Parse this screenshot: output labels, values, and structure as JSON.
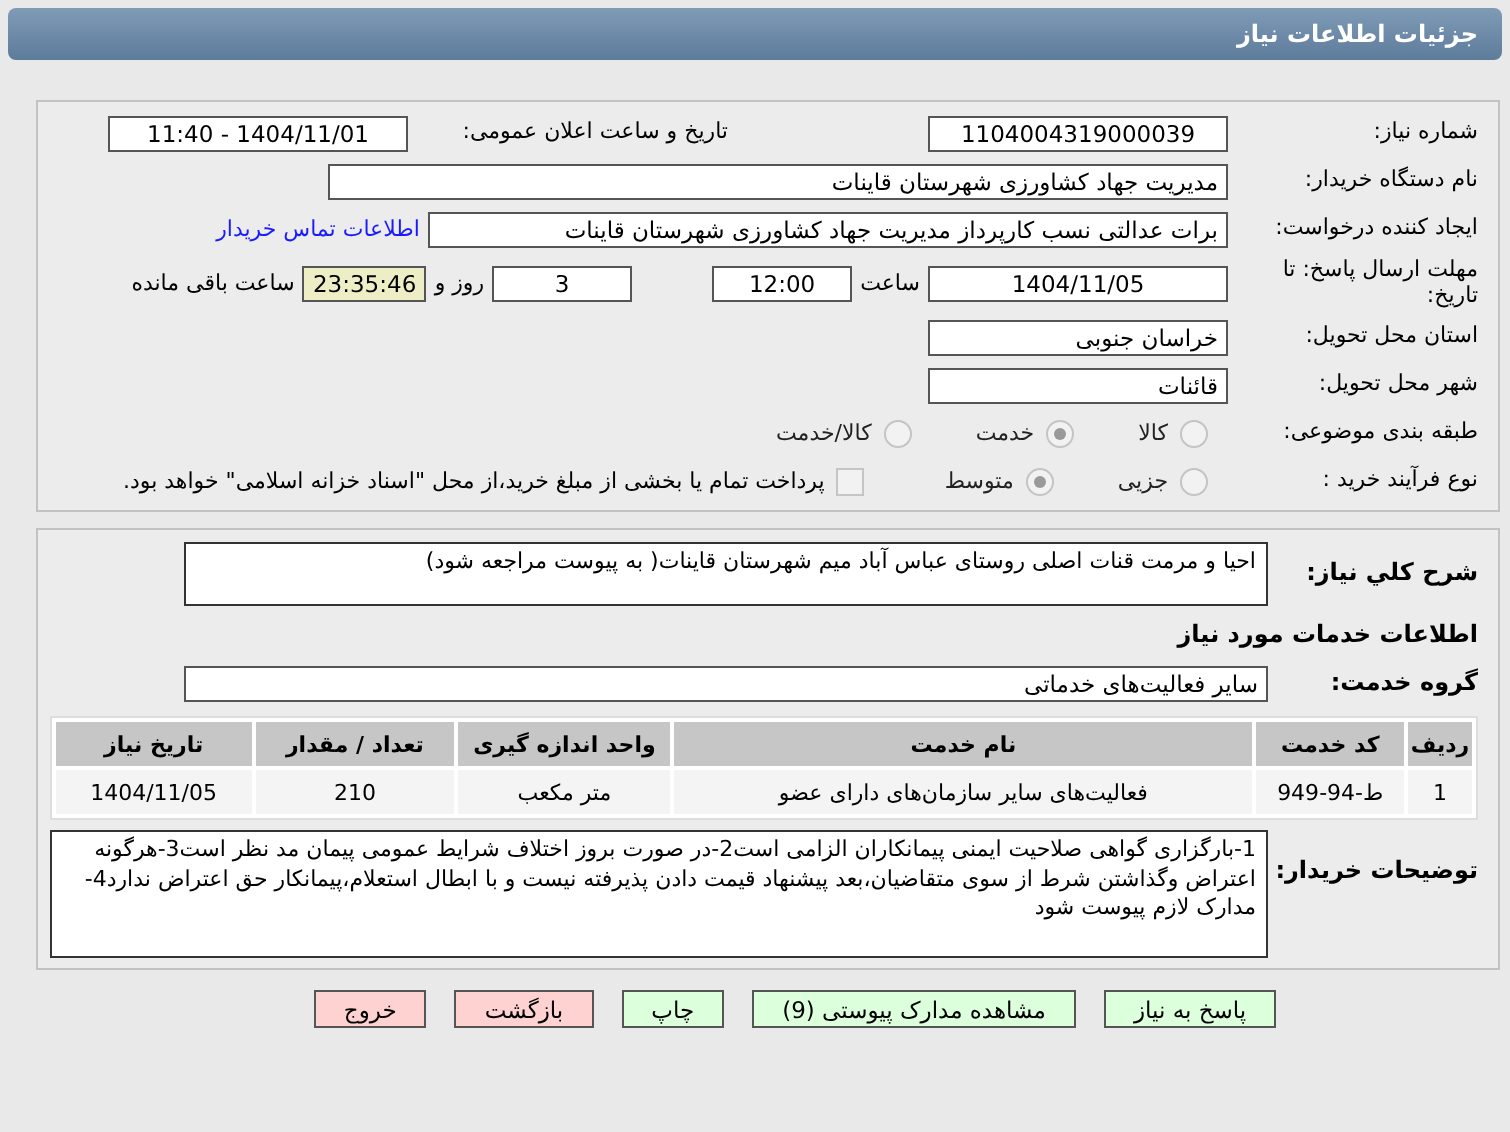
{
  "header": {
    "title": "جزئیات اطلاعات نیاز"
  },
  "details": {
    "need_number": {
      "label": "شماره نیاز:",
      "value": "1104004319000039"
    },
    "announce": {
      "label": "تاریخ و ساعت اعلان عمومی:",
      "value": "1404/11/01 - 11:40"
    },
    "buyer": {
      "label": "نام دستگاه خریدار:",
      "value": "مدیریت جهاد کشاورزی شهرستان قاینات"
    },
    "creator": {
      "label": "ایجاد کننده درخواست:",
      "value": "برات عدالتی نسب کارپرداز مدیریت جهاد کشاورزی شهرستان قاینات",
      "link": "اطلاعات تماس خریدار"
    },
    "deadline": {
      "label": "مهلت ارسال پاسخ: تا تاریخ:",
      "date": "1404/11/05",
      "time_label": "ساعت",
      "time": "12:00",
      "days": "3",
      "days_label": "روز و",
      "remaining": "23:35:46",
      "remaining_label": "ساعت باقی مانده"
    },
    "province": {
      "label": "استان محل تحویل:",
      "value": "خراسان جنوبی"
    },
    "city": {
      "label": "شهر محل تحویل:",
      "value": "قائنات"
    },
    "category": {
      "label": "طبقه بندی موضوعی:",
      "options": [
        {
          "label": "کالا",
          "selected": false
        },
        {
          "label": "خدمت",
          "selected": true
        },
        {
          "label": "کالا/خدمت",
          "selected": false
        }
      ]
    },
    "process": {
      "label": "نوع فرآیند خرید :",
      "options": [
        {
          "label": "جزیی",
          "selected": false
        },
        {
          "label": "متوسط",
          "selected": true
        }
      ],
      "payment": {
        "label": "پرداخت تمام یا بخشی از مبلغ خرید،از محل \"اسناد خزانه اسلامی\" خواهد بود.",
        "checked": false
      }
    }
  },
  "services": {
    "description": {
      "label": "شرح کلي نياز:",
      "value": "احیا و مرمت قنات اصلی روستای عباس آباد میم شهرستان قاینات( به پیوست مراجعه شود)"
    },
    "heading": "اطلاعات خدمات مورد نیاز",
    "group": {
      "label": "گروه خدمت:",
      "value": "سایر فعالیت‌های خدماتی"
    },
    "table": {
      "columns": [
        "ردیف",
        "کد خدمت",
        "نام خدمت",
        "واحد اندازه گیری",
        "تعداد / مقدار",
        "تاریخ نیاز"
      ],
      "rows": [
        [
          "1",
          "ط-94-949",
          "فعالیت‌های سایر سازمان‌های دارای عضو",
          "متر مکعب",
          "210",
          "1404/11/05"
        ]
      ]
    },
    "notes": {
      "label": "توضیحات خریدار:",
      "value": "1-بارگزاری گواهی صلاحیت ایمنی پیمانکاران الزامی است2-در صورت بروز اختلاف شرایط عمومی پیمان مد نظر است3-هرگونه اعتراض وگذاشتن شرط از سوی متقاضیان،بعد پیشنهاد قیمت دادن پذیرفته نیست و با ابطال استعلام،پیمانکار حق اعتراض ندارد4-مدارک لازم پیوست شود"
    }
  },
  "buttons": [
    {
      "label": "پاسخ به نیاز",
      "kind": "primary"
    },
    {
      "label": "مشاهده مدارک پیوستی (9)",
      "kind": "primary"
    },
    {
      "label": "چاپ",
      "kind": "primary"
    },
    {
      "label": "بازگشت",
      "kind": "danger"
    },
    {
      "label": "خروج",
      "kind": "danger"
    }
  ]
}
